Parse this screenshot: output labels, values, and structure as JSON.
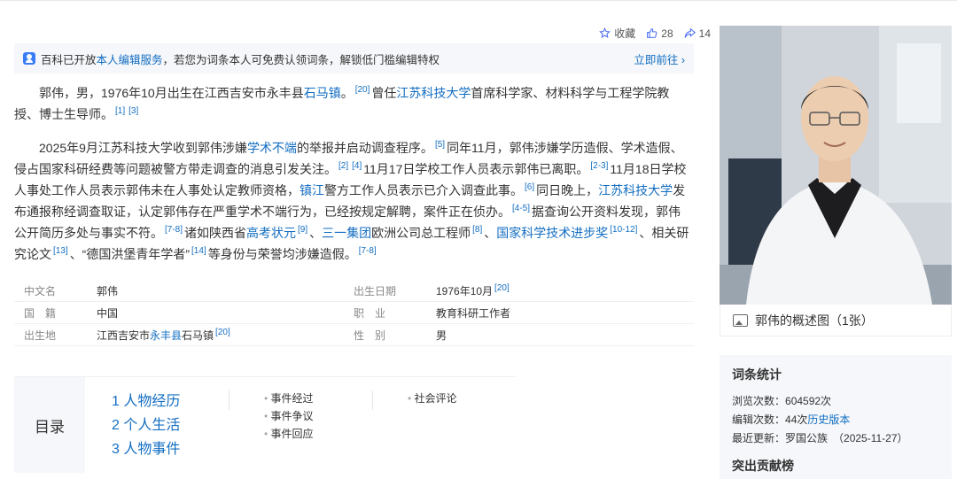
{
  "actions": {
    "favorite_label": "收藏",
    "like_count": "28",
    "share_count": "14"
  },
  "banner": {
    "prefix": "百科已开放",
    "link": "本人编辑服务",
    "rest": "，若您为词条本人可免费认领词条，解锁低门槛编辑特权",
    "go": "立即前往",
    "go_arrow": "›"
  },
  "p1": {
    "t1": "郭伟，男，1976年10月出生在江西吉安市永丰县",
    "l1": "石马镇",
    "t2": "。",
    "r1": "[20]",
    "t3": "曾任",
    "l2": "江苏科技大学",
    "t4": "首席科学家、材料科学与工程学院教授、博士生导师。",
    "r2": "[1]",
    "r3": "[3]"
  },
  "p2": {
    "t1": "2025年9月江苏科技大学收到郭伟涉嫌",
    "l1": "学术不端",
    "t2": "的举报并启动调查程序。",
    "r1": "[5]",
    "t3": "同年11月，郭伟涉嫌学历造假、学术造假、侵占国家科研经费等问题被警方带走调查的消息引发关注。",
    "r2": "[2]",
    "r3": "[4]",
    "t4": "11月17日学校工作人员表示郭伟已离职。",
    "r4": "[2-3]",
    "t5": "11月18日学校人事处工作人员表示郭伟未在人事处认定教师资格，",
    "l2": "镇江",
    "t6": "警方工作人员表示已介入调查此事。",
    "r5": "[6]",
    "t7": "同日晚上，",
    "l3": "江苏科技大学",
    "t8": "发布通报称经调查取证，认定郭伟存在严重学术不端行为，已经按规定解聘，案件正在侦办。",
    "r6": "[4-5]",
    "t9": "据查询公开资料发现，郭伟公开简历多处与事实不符。",
    "r7": "[7-8]",
    "t10": "诸如陕西省",
    "l4": "高考状元",
    "r8": "[9]",
    "t11": "、",
    "l5": "三一集团",
    "t12": "欧洲公司总工程师",
    "r9": "[8]",
    "t13": "、",
    "l6": "国家科学技术进步奖",
    "r10": "[10-12]",
    "t14": "、相关研究论文",
    "r11": "[13]",
    "t15": "、“德国洪堡青年学者”",
    "r12": "[14]",
    "t16": "等身份与荣誉均涉嫌造假。",
    "r13": "[7-8]"
  },
  "info": {
    "rows": [
      {
        "k": "中文名",
        "v": "郭伟",
        "k2": "出生日期",
        "v2": "1976年10月",
        "v2ref": "[20]"
      },
      {
        "k": "国　籍",
        "v": "中国",
        "k2": "职　业",
        "v2": "教育科研工作者"
      },
      {
        "k": "出生地",
        "v_pre": "江西吉安市",
        "v_link": "永丰县",
        "v_post": "石马镇",
        "v_ref": "[20]",
        "k2": "性　别",
        "v2": "男"
      }
    ]
  },
  "toc": {
    "title": "目录",
    "items": [
      "1 人物经历",
      "2 个人生活",
      "3 人物事件"
    ],
    "sub": [
      "事件经过",
      "事件争议",
      "事件回应"
    ],
    "sub2": [
      "社会评论"
    ]
  },
  "photo": {
    "caption": "郭伟的概述图（1张）"
  },
  "stats": {
    "title": "词条统计",
    "views_label": "浏览次数：",
    "views": "604592次",
    "edits_label": "编辑次数：",
    "edits": "44次",
    "history": "历史版本",
    "updated_label": "最近更新：",
    "updated": "罗国公族　（2025-11-27）",
    "next_title": "突出贡献榜"
  }
}
